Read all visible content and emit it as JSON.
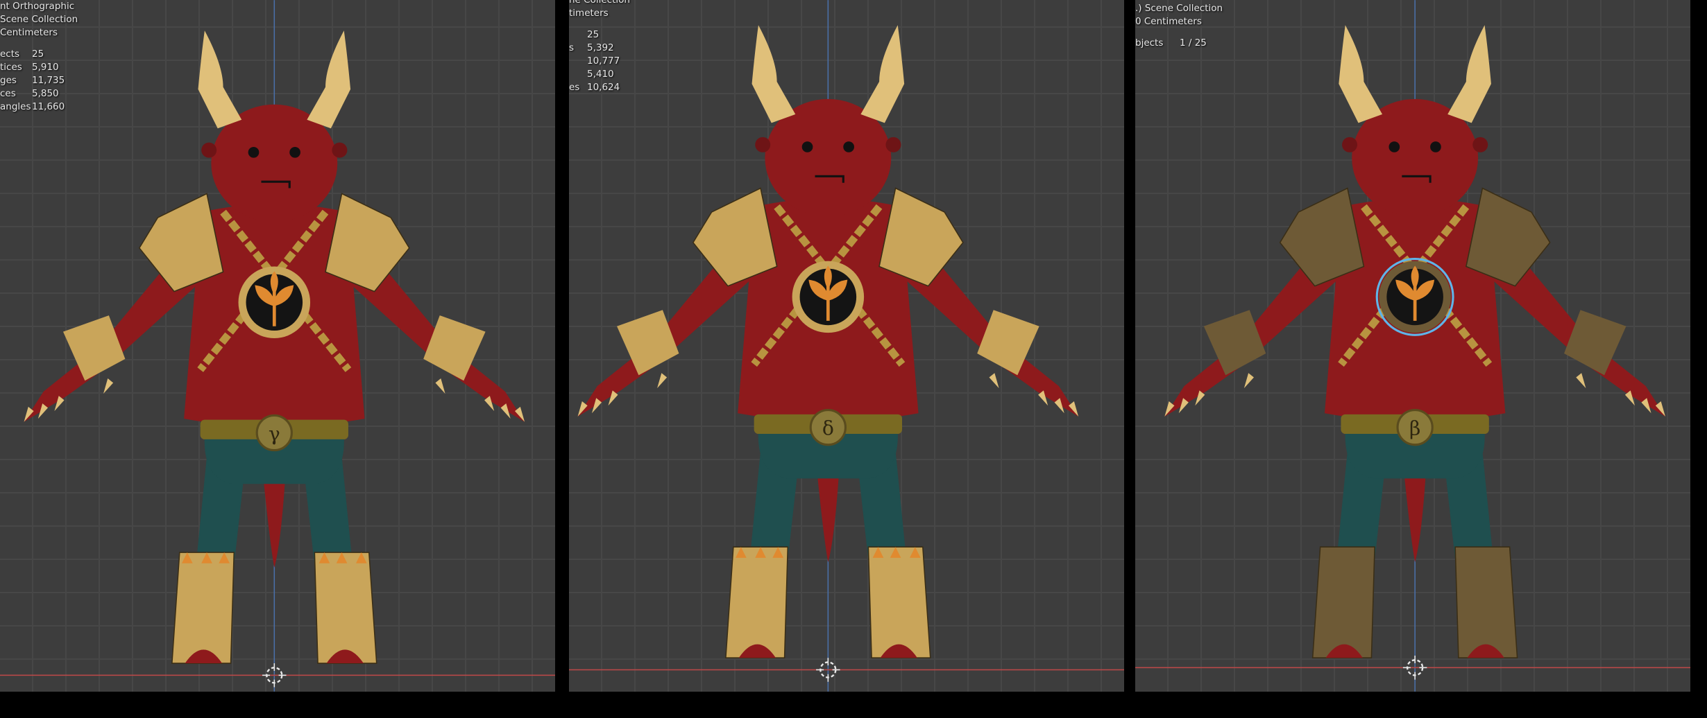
{
  "viewports": [
    {
      "overlay_lines": [
        "nt Orthographic",
        "Scene Collection",
        "Centimeters"
      ],
      "stats": [
        {
          "label": "ects",
          "value": "25"
        },
        {
          "label": "tices",
          "value": "5,910"
        },
        {
          "label": "ges",
          "value": "11,735"
        },
        {
          "label": "ces",
          "value": "5,850"
        },
        {
          "label": "angles",
          "value": "11,660"
        }
      ],
      "belt_symbol": "γ",
      "variant": "studded"
    },
    {
      "overlay_lines": [
        "",
        "ne Collection",
        "timeters"
      ],
      "stats": [
        {
          "label": "",
          "value": "25"
        },
        {
          "label": "s",
          "value": "5,392"
        },
        {
          "label": "",
          "value": "10,777"
        },
        {
          "label": "",
          "value": "5,410"
        },
        {
          "label": "es",
          "value": "10,624"
        }
      ],
      "belt_symbol": "δ",
      "variant": "spiked"
    },
    {
      "overlay_lines": [
        ".) Scene Collection",
        "0 Centimeters"
      ],
      "stats": [
        {
          "label": "bjects",
          "value": "1 / 25"
        }
      ],
      "belt_symbol": "β",
      "variant": "bronze"
    }
  ],
  "colors": {
    "viewport_bg": "#3d3d3d",
    "grid": "#474747",
    "skin": "#8e1a1c",
    "gold": "#c9a55a",
    "bronze": "#6e5a36",
    "teal": "#1f4f4f",
    "horn": "#e0c07a",
    "axis_x": "#b84848",
    "axis_z": "#4a6fa8",
    "selection": "#5fb4e8"
  }
}
